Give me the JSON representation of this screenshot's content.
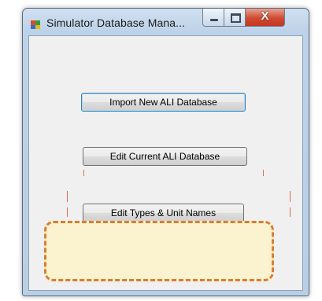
{
  "window": {
    "title": "Simulator Database Mana...",
    "controls": {
      "minimize": "",
      "maximize": "",
      "close": "X"
    }
  },
  "buttons": {
    "import": "Import New ALI Database",
    "edit": "Edit Current ALI Database",
    "types": "Edit Types & Unit Names"
  },
  "colors": {
    "highlight_fill": "#fbf2cf",
    "highlight_border": "#e07c2c",
    "close_button": "#cf4a31",
    "focus_border": "#3c7fb1"
  },
  "icons": {
    "app": "app-window-icon",
    "minimize": "minimize-icon",
    "maximize": "maximize-icon",
    "close": "close-icon"
  }
}
